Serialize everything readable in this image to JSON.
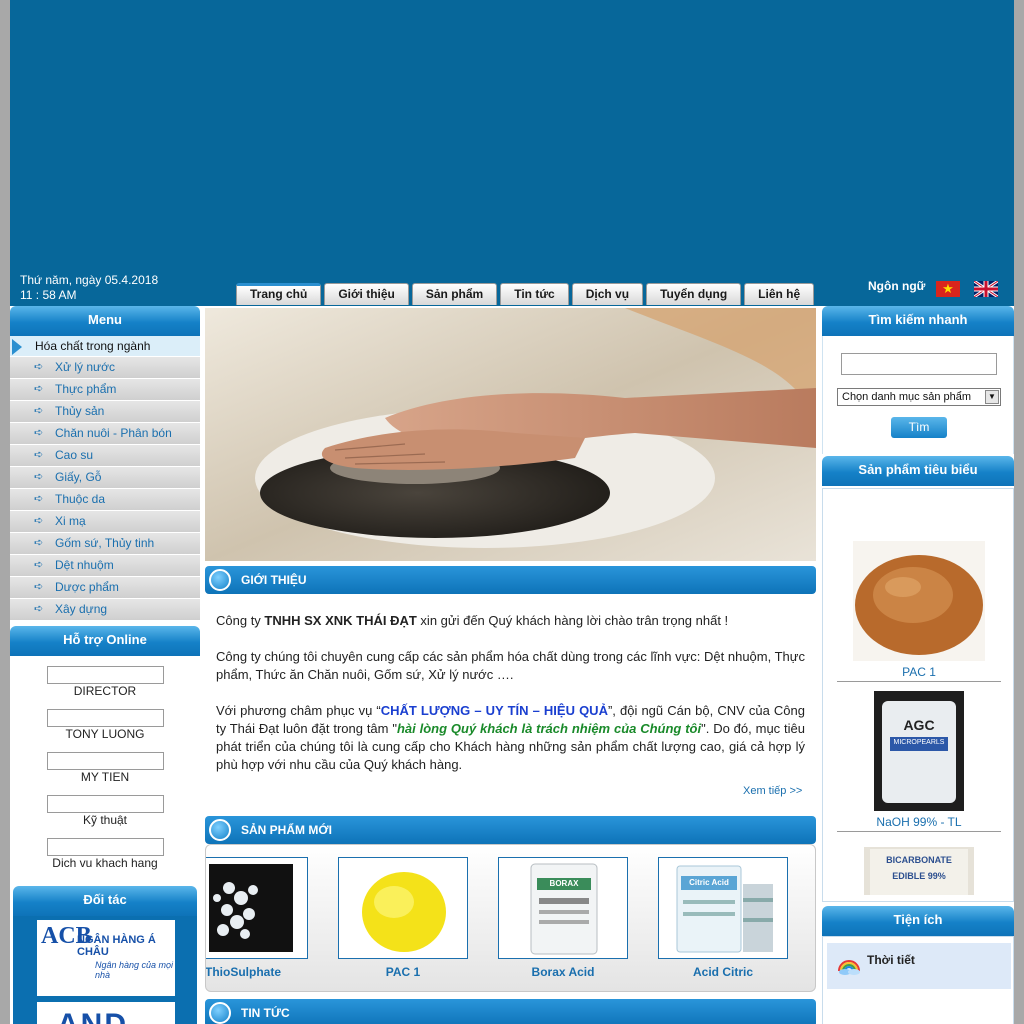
{
  "header": {
    "date": "Thứ năm, ngày 05.4.2018",
    "time": "11 : 58 AM",
    "language_label": "Ngôn ngữ"
  },
  "nav": {
    "tabs": [
      "Trang chủ",
      "Giới thiệu",
      "Sản phẩm",
      "Tin tức",
      "Dịch vụ",
      "Tuyển dụng",
      "Liên hệ"
    ],
    "active": "Trang chủ"
  },
  "sidebar": {
    "menu_title": "Menu",
    "category": "Hóa chất trong ngành",
    "items": [
      "Xử lý nước",
      "Thực phẩm",
      "Thủy sản",
      "Chăn nuôi - Phân bón",
      "Cao su",
      "Giấy, Gỗ",
      "Thuộc da",
      "Xi mạ",
      "Gốm sứ, Thủy tinh",
      "Dệt nhuộm",
      "Dược phẩm",
      "Xây dựng"
    ],
    "support_title": "Hỗ trợ Online",
    "support_contacts": [
      "DIRECTOR",
      "TONY LUONG",
      "MY TIEN",
      "Kỹ thuật",
      "Dich vu khach hang"
    ],
    "partners_title": "Đối tác",
    "partner_logos": {
      "acb_mark": "ACB",
      "acb_name": "NGÂN HÀNG Á CHÂU",
      "acb_slogan": "Ngân hàng của mọi nhà",
      "and_mark": "AND"
    }
  },
  "main": {
    "intro_title": "GIỚI THIỆU",
    "intro_p1_pre": "Công ty ",
    "intro_p1_company": "TNHH SX XNK THÁI ĐẠT",
    "intro_p1_post": " xin gửi đến Quý khách hàng lời chào trân trọng nhất !",
    "intro_p2": "Công ty chúng tôi chuyên cung cấp các sản phẩm hóa chất dùng trong các lĩnh vực: Dệt nhuộm, Thực phẩm, Thức ăn Chăn nuôi, Gốm sứ, Xử lý nước ….",
    "intro_p3_a": "Với phương châm phục vụ “",
    "intro_p3_motto": "CHẤT LƯỢNG – UY TÍN – HIỆU QUẢ",
    "intro_p3_b": "”, đội ngũ Cán bộ, CNV của Công ty Thái Đạt luôn đặt trong tâm \"",
    "intro_p3_quote": "hài lòng Quý khách là trách nhiệm của Chúng tôi",
    "intro_p3_c": "\". Do đó, mục tiêu phát triển của chúng tôi là cung cấp cho Khách hàng những sản phẩm chất lượng cao, giá cả hợp lý phù hợp với nhu cầu của Quý khách hàng.",
    "more_link": "Xem tiếp >>",
    "new_products_title": "SẢN PHẨM MỚI",
    "new_products": [
      "ThioSulphate",
      "PAC 1",
      "Borax Acid",
      "Acid Citric"
    ],
    "news_title": "TIN TỨC"
  },
  "right": {
    "search_title": "Tìm kiếm nhanh",
    "search_placeholder": "",
    "category_select": "Chọn danh mục sản phẩm",
    "search_button": "Tìm",
    "featured_title": "Sản phẩm tiêu biểu",
    "featured": [
      "PAC 1",
      "NaOH 99% - TL"
    ],
    "bag_label": "AGC",
    "bag_sub": "MICROPEARLS",
    "bicarb_label": "BICARBONATE",
    "bicarb_sub": "EDIBLE 99%",
    "borax_bag_label": "BORAX",
    "citric_bag_label": "Citric Acid",
    "utilities_title": "Tiện ích",
    "weather_label": "Thời tiết"
  }
}
